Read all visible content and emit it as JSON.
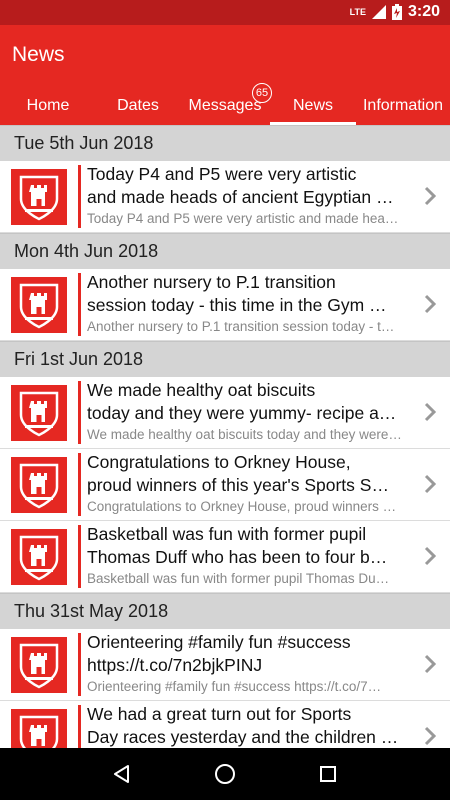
{
  "status_bar": {
    "network": "LTE",
    "time": "3:20"
  },
  "app": {
    "title": "News"
  },
  "tabs": [
    {
      "label": "Home"
    },
    {
      "label": "Dates"
    },
    {
      "label": "Messages",
      "badge": "65"
    },
    {
      "label": "News"
    },
    {
      "label": "Information"
    }
  ],
  "sections": [
    {
      "date": "Tue 5th Jun 2018",
      "items": [
        {
          "title_line1": "Today P4 and P5 were very artistic",
          "title_line2": "and made heads of ancient Egyptian …",
          "preview": "Today P4 and P5 were very artistic and made hea…"
        }
      ]
    },
    {
      "date": "Mon 4th Jun 2018",
      "items": [
        {
          "title_line1": "Another nursery to P.1 transition",
          "title_line2": "session today - this time in the Gym …",
          "preview": "Another nursery to P.1 transition session today - t…"
        }
      ]
    },
    {
      "date": "Fri 1st Jun 2018",
      "items": [
        {
          "title_line1": "We made healthy oat biscuits",
          "title_line2": "today and they were yummy- recipe a…",
          "preview": "We made healthy oat biscuits today and they were…"
        },
        {
          "title_line1": "Congratulations to Orkney House,",
          "title_line2": "proud winners of this year's Sports S…",
          "preview": "Congratulations to Orkney House, proud winners …"
        },
        {
          "title_line1": "Basketball was fun with former pupil",
          "title_line2": "Thomas Duff who has been to four b…",
          "preview": "Basketball was fun with former pupil Thomas Du…"
        }
      ]
    },
    {
      "date": "Thu 31st May 2018",
      "items": [
        {
          "title_line1": "Orienteering #family fun #success",
          "title_line2": "https://t.co/7n2bjkPINJ",
          "preview": "Orienteering #family fun #success https://t.co/7…"
        },
        {
          "title_line1": "We had a great turn out for Sports",
          "title_line2": "Day races yesterday and the children …",
          "preview": ""
        }
      ]
    }
  ],
  "colors": {
    "primary": "#e52822",
    "status": "#b71c1c",
    "header_bg": "#d4d4d4"
  },
  "icons": {
    "logo": "school-crest-icon",
    "chevron": "chevron-right-icon",
    "back": "back-triangle-icon",
    "home": "home-circle-icon",
    "recents": "recents-square-icon"
  }
}
